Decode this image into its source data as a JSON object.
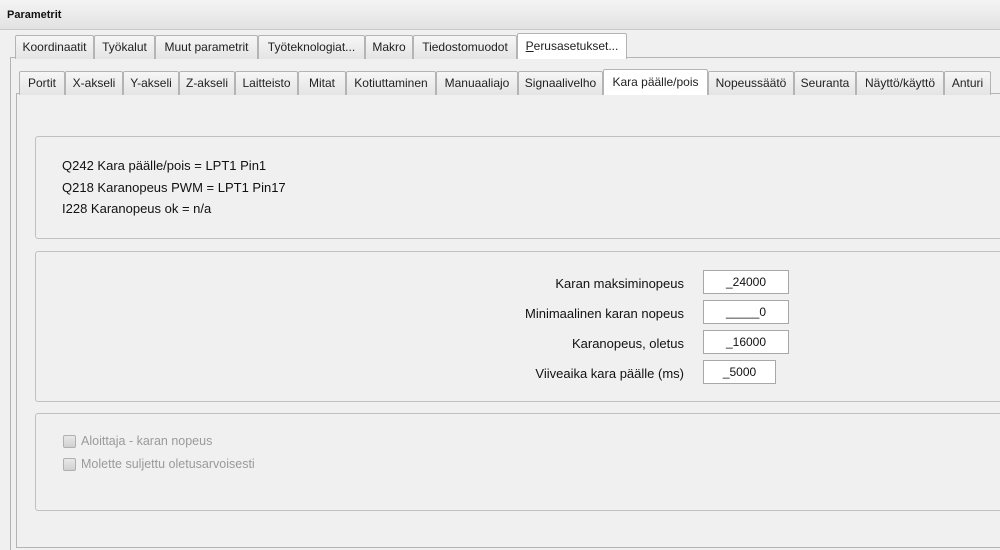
{
  "window": {
    "title": "Parametrit"
  },
  "main_tabs": [
    {
      "label": "Koordinaatit"
    },
    {
      "label": "Työkalut"
    },
    {
      "label": "Muut parametrit"
    },
    {
      "label": "Työteknologiat..."
    },
    {
      "label": "Makro"
    },
    {
      "label": "Tiedostomuodot"
    },
    {
      "label_first": "P",
      "label_rest": "erusasetukset...",
      "active": true
    }
  ],
  "sub_tabs": [
    {
      "label": "Portit"
    },
    {
      "label": "X-akseli"
    },
    {
      "label": "Y-akseli"
    },
    {
      "label": "Z-akseli"
    },
    {
      "label": "Laitteisto"
    },
    {
      "label": "Mitat"
    },
    {
      "label": "Kotiuttaminen"
    },
    {
      "label": "Manuaaliajo"
    },
    {
      "label": "Signaalivelho"
    },
    {
      "label": "Kara päälle/pois",
      "active": true
    },
    {
      "label": "Nopeussäätö"
    },
    {
      "label": "Seuranta"
    },
    {
      "label": "Näyttö/käyttö"
    },
    {
      "label": "Anturi"
    }
  ],
  "info": {
    "lines": [
      "Q242 Kara päälle/pois = LPT1 Pin1",
      "Q218 Karanopeus PWM = LPT1 Pin17",
      "I228 Karanopeus ok = n/a"
    ]
  },
  "form": {
    "fields": [
      {
        "label": "Karan maksiminopeus",
        "value": "_24000"
      },
      {
        "label": "Minimaalinen karan nopeus",
        "value": "_____0"
      },
      {
        "label": "Karanopeus, oletus",
        "value": "_16000"
      },
      {
        "label": "Viiveaika kara päälle (ms)",
        "value": "_5000"
      }
    ]
  },
  "options": {
    "checkboxes": [
      {
        "label": "Aloittaja - karan nopeus",
        "checked": false,
        "disabled": true
      },
      {
        "label": "Molette suljettu oletusarvoisesti",
        "checked": false,
        "disabled": true
      }
    ]
  }
}
